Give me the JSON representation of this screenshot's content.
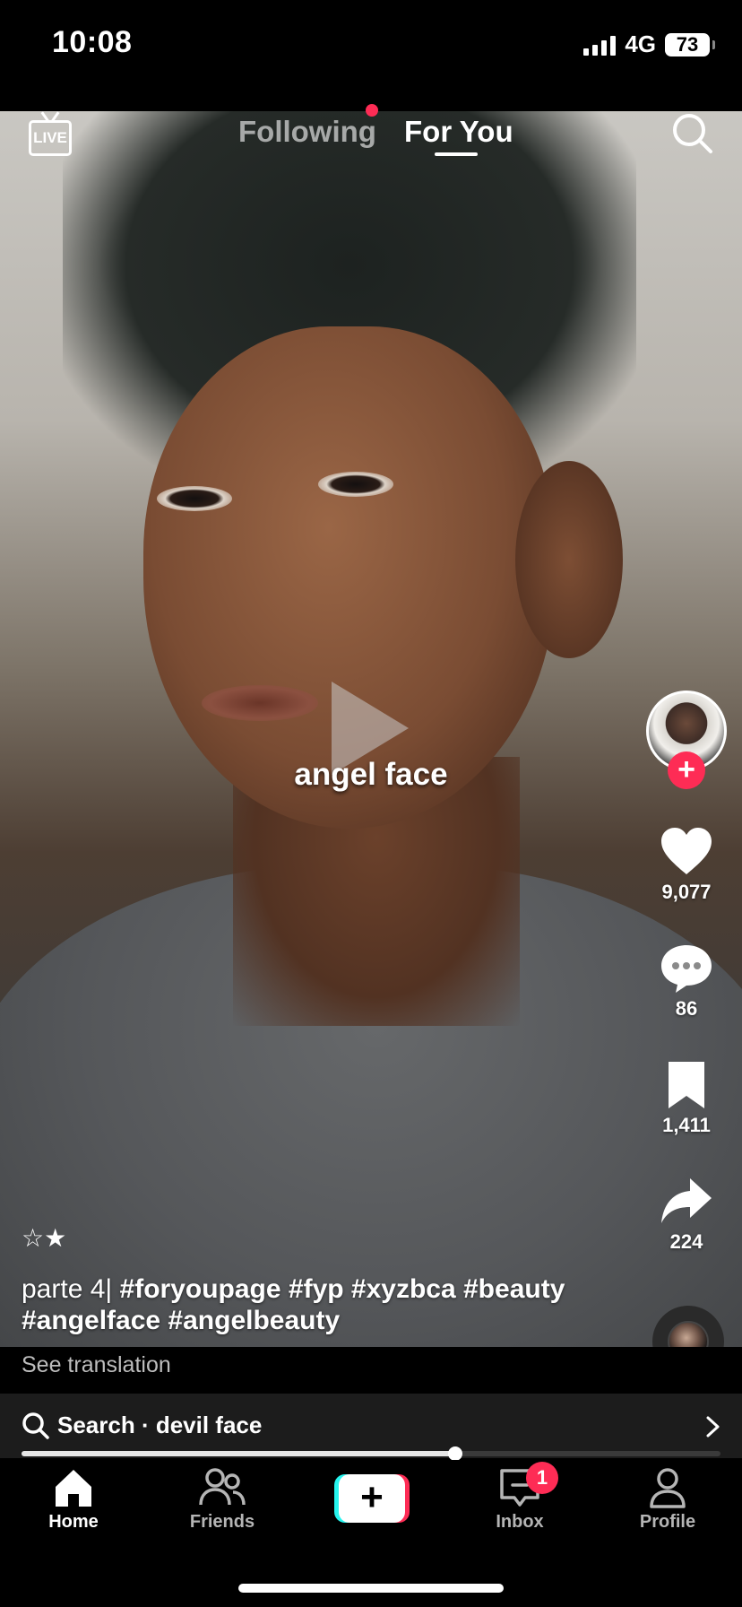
{
  "status_bar": {
    "time": "10:08",
    "network": "4G",
    "battery": "73"
  },
  "top_nav": {
    "live_label": "LIVE",
    "tab_following": "Following",
    "tab_for_you": "For You",
    "active_tab": "For You",
    "following_has_notification": true,
    "search_icon": "search-icon"
  },
  "video": {
    "caption_overlay": "angel face",
    "state": "paused"
  },
  "actions": {
    "likes": "9,077",
    "comments": "86",
    "bookmarks": "1,411",
    "shares": "224",
    "follow_icon": "plus-icon"
  },
  "post": {
    "stars": "☆★",
    "description_prefix": "parte 4| ",
    "description_tags": "#foryoupage #fyp #xyzbca #beauty #angelface #angelbeauty",
    "see_translation": "See translation"
  },
  "search_suggestion": {
    "label": "Search · ",
    "query": "devil face"
  },
  "playback": {
    "progress": 0.62
  },
  "tab_bar": {
    "home": "Home",
    "friends": "Friends",
    "inbox": "Inbox",
    "inbox_badge": "1",
    "profile": "Profile",
    "active": "Home"
  },
  "colors": {
    "accent": "#fe2c55",
    "cyan": "#25f4ee"
  }
}
